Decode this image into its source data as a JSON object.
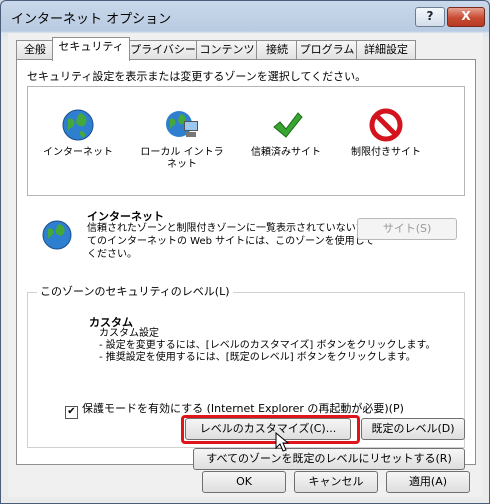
{
  "window": {
    "title": "インターネット オプション",
    "help_label": "?",
    "close_label": "X"
  },
  "tabs": [
    {
      "label": "全般"
    },
    {
      "label": "セキュリティ"
    },
    {
      "label": "プライバシー"
    },
    {
      "label": "コンテンツ"
    },
    {
      "label": "接続"
    },
    {
      "label": "プログラム"
    },
    {
      "label": "詳細設定"
    }
  ],
  "active_tab": "セキュリティ",
  "zones": {
    "instruction": "セキュリティ設定を表示または変更するゾーンを選択してください。",
    "items": [
      {
        "label": "インターネット",
        "icon": "globe-icon"
      },
      {
        "label": "ローカル イントラネット",
        "icon": "intranet-globe-icon"
      },
      {
        "label": "信頼済みサイト",
        "icon": "green-check-icon"
      },
      {
        "label": "制限付きサイト",
        "icon": "red-stop-icon"
      }
    ]
  },
  "description": {
    "title": "インターネット",
    "text": "信頼されたゾーンと制限付きゾーンに一覧表示されていないすべてのインターネットの Web サイトには、このゾーンを使用してください。",
    "sites_button": "サイト(S)"
  },
  "security_level": {
    "group_title": "このゾーンのセキュリティのレベル(L)",
    "level_name": "カスタム",
    "lines": [
      "カスタム設定",
      "- 設定を変更するには、[レベルのカスタマイズ] ボタンをクリックします。",
      "- 推奨設定を使用するには、[既定のレベル] ボタンをクリックします。"
    ]
  },
  "protected_mode": {
    "label": "保護モードを有効にする (Internet Explorer の再起動が必要)(P)",
    "checked": true
  },
  "buttons": {
    "customize": "レベルのカスタマイズ(C)...",
    "default_level": "既定のレベル(D)",
    "reset_all": "すべてのゾーンを既定のレベルにリセットする(R)",
    "ok": "OK",
    "cancel": "キャンセル",
    "apply": "適用(A)"
  },
  "colors": {
    "highlight": "#e0151b",
    "close_button": "#c74a32"
  }
}
